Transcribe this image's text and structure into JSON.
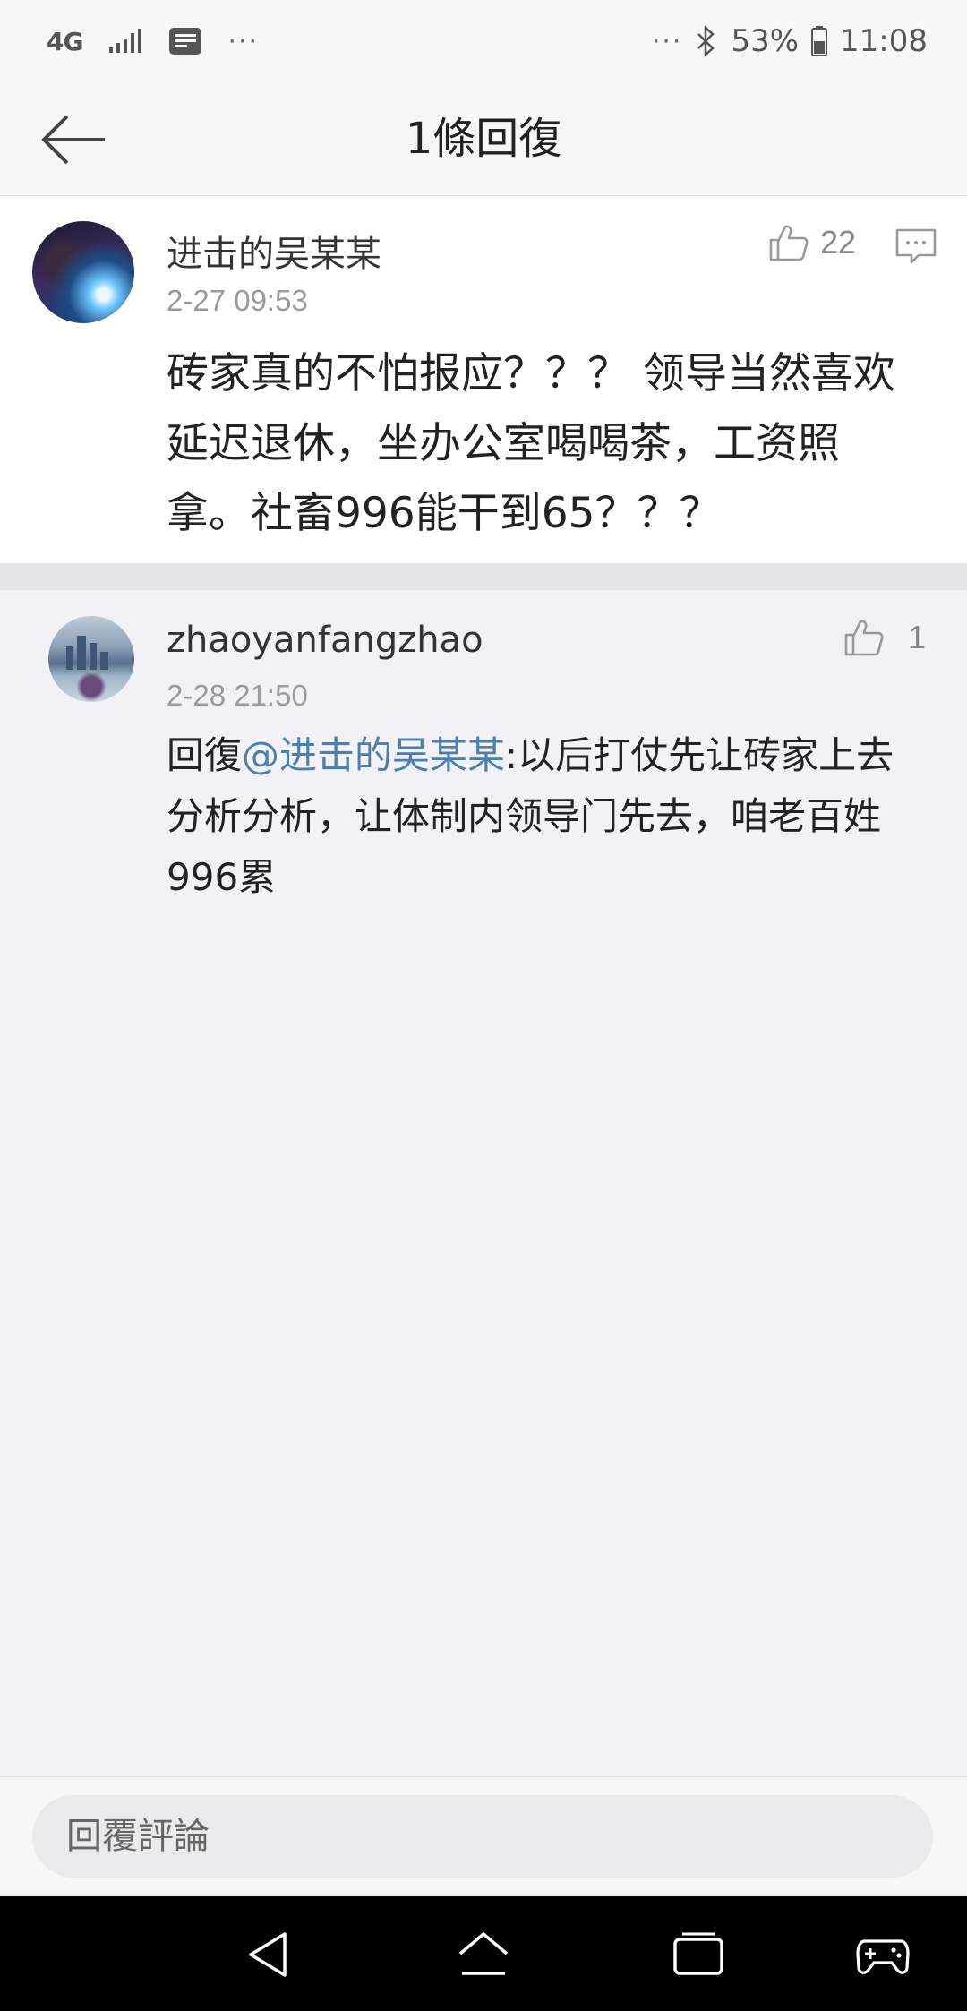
{
  "status_bar": {
    "network": "4G",
    "dots_left": "···",
    "dots_right": "···",
    "battery": "53%",
    "time": "11:08"
  },
  "header": {
    "title": "1條回復"
  },
  "main_comment": {
    "username": "进击的吴某某",
    "time": "2-27 09:53",
    "likes": "22",
    "text": "砖家真的不怕报应？？？ 领导当然喜欢延迟退休，坐办公室喝喝茶，工资照拿。社畜996能干到65？？？"
  },
  "reply": {
    "username": "zhaoyanfangzhao",
    "time": "2-28 21:50",
    "likes": "1",
    "prefix": "回復",
    "mention": "@进击的吴某某",
    "text": ":以后打仗先让砖家上去分析分析，让体制内领导门先去，咱老百姓996累"
  },
  "input": {
    "placeholder": "回覆評論"
  },
  "icons": {
    "back": "arrow-left-icon",
    "like": "thumbs-up-icon",
    "comment": "comment-icon",
    "bluetooth": "bluetooth-icon",
    "battery": "battery-icon",
    "signal": "signal-icon",
    "message": "message-icon",
    "nav_back": "triangle-back-icon",
    "nav_home": "home-icon",
    "nav_recent": "recent-apps-icon",
    "nav_game": "gamepad-icon"
  }
}
